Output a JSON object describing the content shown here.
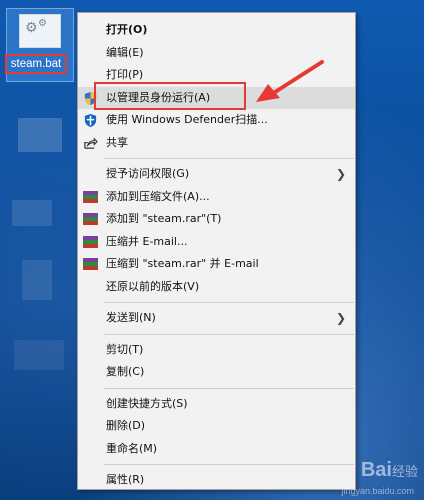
{
  "desktop": {
    "icon_label": "steam.bat"
  },
  "context_menu": {
    "items": [
      {
        "label": "打开(O)"
      },
      {
        "label": "编辑(E)"
      },
      {
        "label": "打印(P)"
      },
      {
        "label": "以管理员身份运行(A)"
      },
      {
        "label": "使用 Windows Defender扫描..."
      },
      {
        "label": "共享"
      },
      {
        "label": "授予访问权限(G)"
      },
      {
        "label": "添加到压缩文件(A)..."
      },
      {
        "label": "添加到 \"steam.rar\"(T)"
      },
      {
        "label": "压缩并 E-mail..."
      },
      {
        "label": "压缩到 \"steam.rar\" 并 E-mail"
      },
      {
        "label": "还原以前的版本(V)"
      },
      {
        "label": "发送到(N)"
      },
      {
        "label": "剪切(T)"
      },
      {
        "label": "复制(C)"
      },
      {
        "label": "创建快捷方式(S)"
      },
      {
        "label": "删除(D)"
      },
      {
        "label": "重命名(M)"
      },
      {
        "label": "属性(R)"
      }
    ]
  },
  "watermark": {
    "brand": "Bai",
    "brand2": "经验",
    "url": "jingyan.baidu.com"
  },
  "colors": {
    "highlight": "#dcdcdc",
    "annotation_red": "#e53935",
    "menu_bg": "#f2f2f2"
  }
}
